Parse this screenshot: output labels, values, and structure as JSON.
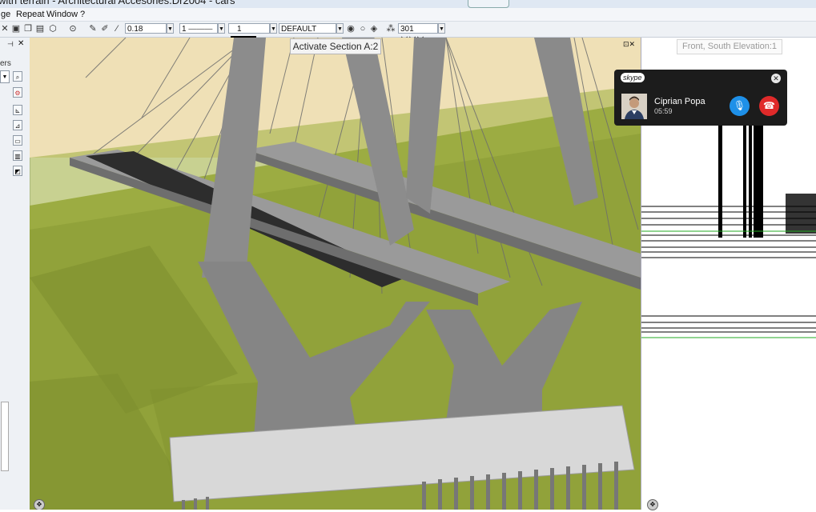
{
  "window": {
    "title": "with terrain - Architectural Accesories.Dr2004 - cars"
  },
  "menu": {
    "items": [
      "ge",
      "Repeat",
      "Window",
      "?"
    ]
  },
  "toolbar": {
    "lineweight": "0.18",
    "linestyle": "1",
    "color_index": "1",
    "layer": "DEFAULT",
    "pattern": "301"
  },
  "left_panel": {
    "label": "ers"
  },
  "viewport": {
    "tooltip": "Activate Section A:2"
  },
  "right_view": {
    "title": "Front, South Elevation:1"
  },
  "skype": {
    "app": "skype",
    "caller": "Ciprian Popa",
    "duration": "05:59"
  },
  "colors": {
    "sky": "#efe0b6",
    "grass": "#91a23a",
    "concrete": "#8c8c8c",
    "skype_bg": "#1c1c1c",
    "mic_blue": "#1e90e8",
    "end_red": "#e02a2a"
  }
}
